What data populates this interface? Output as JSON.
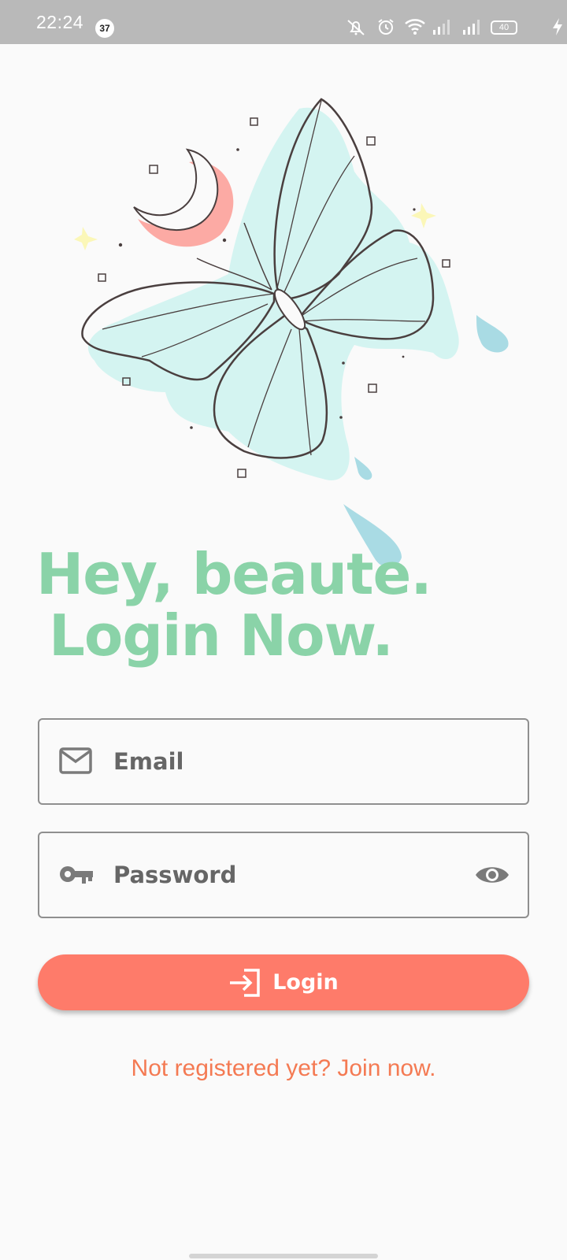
{
  "status_bar": {
    "time": "22:24",
    "notification_count": "37",
    "battery_level": "40",
    "icons": [
      "mute-icon",
      "alarm-icon",
      "wifi-icon",
      "signal-icon",
      "signal-icon",
      "battery-icon",
      "charging-icon"
    ]
  },
  "hero": {
    "illustration": "butterfly-moon-illustration"
  },
  "headline": {
    "line1": "Hey, beaute.",
    "line2": "Login Now."
  },
  "form": {
    "email": {
      "placeholder": "Email",
      "value": "",
      "icon": "mail-icon"
    },
    "password": {
      "placeholder": "Password",
      "value": "",
      "icon": "key-icon",
      "toggle_icon": "eye-icon"
    }
  },
  "login_button": {
    "label": "Login",
    "icon": "login-icon",
    "color": "#fe7b6a"
  },
  "signup_link": {
    "label": "Not registered yet? Join now."
  },
  "colors": {
    "headline": "#8ad3a8",
    "accent": "#fe7b6a",
    "link": "#f47a53",
    "background": "#fafafa"
  }
}
